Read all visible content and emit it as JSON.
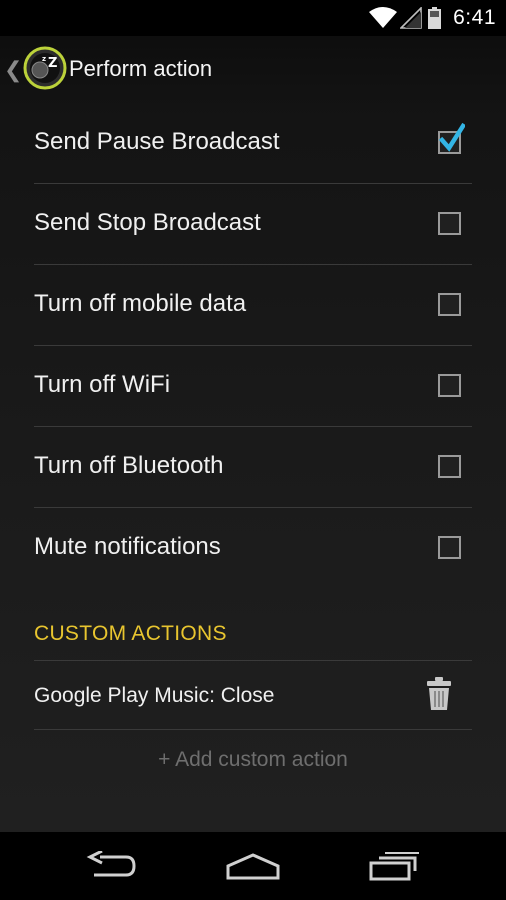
{
  "status_bar": {
    "time": "6:41",
    "icons": [
      "wifi-icon",
      "signal-icon",
      "battery-icon"
    ]
  },
  "action_bar": {
    "title": "Perform action",
    "icons": [
      "back-caret-icon",
      "app-logo-icon"
    ]
  },
  "actions": [
    {
      "label": "Send Pause Broadcast",
      "checked": true
    },
    {
      "label": "Send Stop Broadcast",
      "checked": false
    },
    {
      "label": "Turn off mobile data",
      "checked": false
    },
    {
      "label": "Turn off WiFi",
      "checked": false
    },
    {
      "label": "Turn off Bluetooth",
      "checked": false
    },
    {
      "label": "Mute notifications",
      "checked": false
    }
  ],
  "custom_actions": {
    "header": "CUSTOM ACTIONS",
    "items": [
      {
        "label": "Google Play Music: Close",
        "icon": "trash-icon"
      }
    ],
    "add_label": "+ Add custom action"
  },
  "nav_bar": {
    "icons": [
      "back-icon",
      "home-icon",
      "recents-icon"
    ]
  },
  "colors": {
    "accent": "#33b5e5",
    "section_header": "#e8c52f",
    "divider": "#3a3a3a",
    "muted_text": "#6e6e6e"
  }
}
